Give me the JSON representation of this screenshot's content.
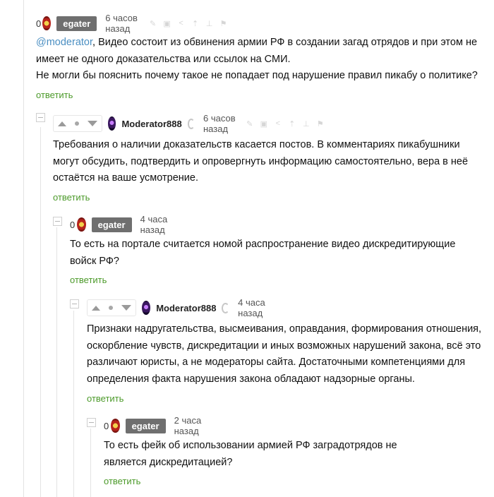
{
  "comments": [
    {
      "rating": "0",
      "author": "egater",
      "time": "6 часов назад",
      "mention": "@moderator",
      "text_line1": ", Видео состоит из обвинения армии РФ в создании загад отрядов и при этом не",
      "text_line2": "имеет не одного доказательства или ссылок на СМИ.",
      "text_line3": "Не могли бы пояснить почему такое не попадает под нарушение правил пикабу о политике?",
      "reply_label": "ответить"
    },
    {
      "author": "Moderator888",
      "time": "6 часов назад",
      "text_line1": "Требования о наличии доказательств касается постов. В комментариях пикабушники",
      "text_line2": "могут обсудить, подтвердить и опровергнуть информацию самостоятельно, вера в неё",
      "text_line3": "остаётся на ваше усмотрение.",
      "reply_label": "ответить"
    },
    {
      "rating": "0",
      "author": "egater",
      "time": "4 часа назад",
      "text_line1": "То есть на портале считается номой распространение видео дискредитирующие",
      "text_line2": "войск РФ?",
      "reply_label": "ответить"
    },
    {
      "author": "Moderator888",
      "time": "4 часа назад",
      "text_line1": "Признаки надругательства, высмеивания, оправдания, формирования отношения,",
      "text_line2": "оскорбление чувств, дискредитации и иных возможных нарушений закона, всё это",
      "text_line3": "различают юристы, а не модераторы сайта. Достаточными компетенциями для",
      "text_line4": "определения факта нарушения закона обладают надзорные органы.",
      "reply_label": "ответить"
    },
    {
      "rating": "0",
      "author": "egater",
      "time": "2 часа назад",
      "text_line1": "То есть фейк об использовании армией РФ заградотрядов не",
      "text_line2": "является дискредитацией?",
      "reply_label": "ответить"
    }
  ],
  "icons": {
    "edit": "pencil-icon",
    "save": "save-icon",
    "share": "share-icon",
    "parent": "arrow-up-icon",
    "branch": "branch-icon",
    "flag": "flag-icon",
    "vote_up": "vote-up-icon",
    "vote_down": "vote-down-icon",
    "moderator_badge": "moderator-badge-icon"
  },
  "colors": {
    "reply_link": "#4c9a2a",
    "mention": "#4b8fc2",
    "author_badge": "#6f6f6f"
  }
}
